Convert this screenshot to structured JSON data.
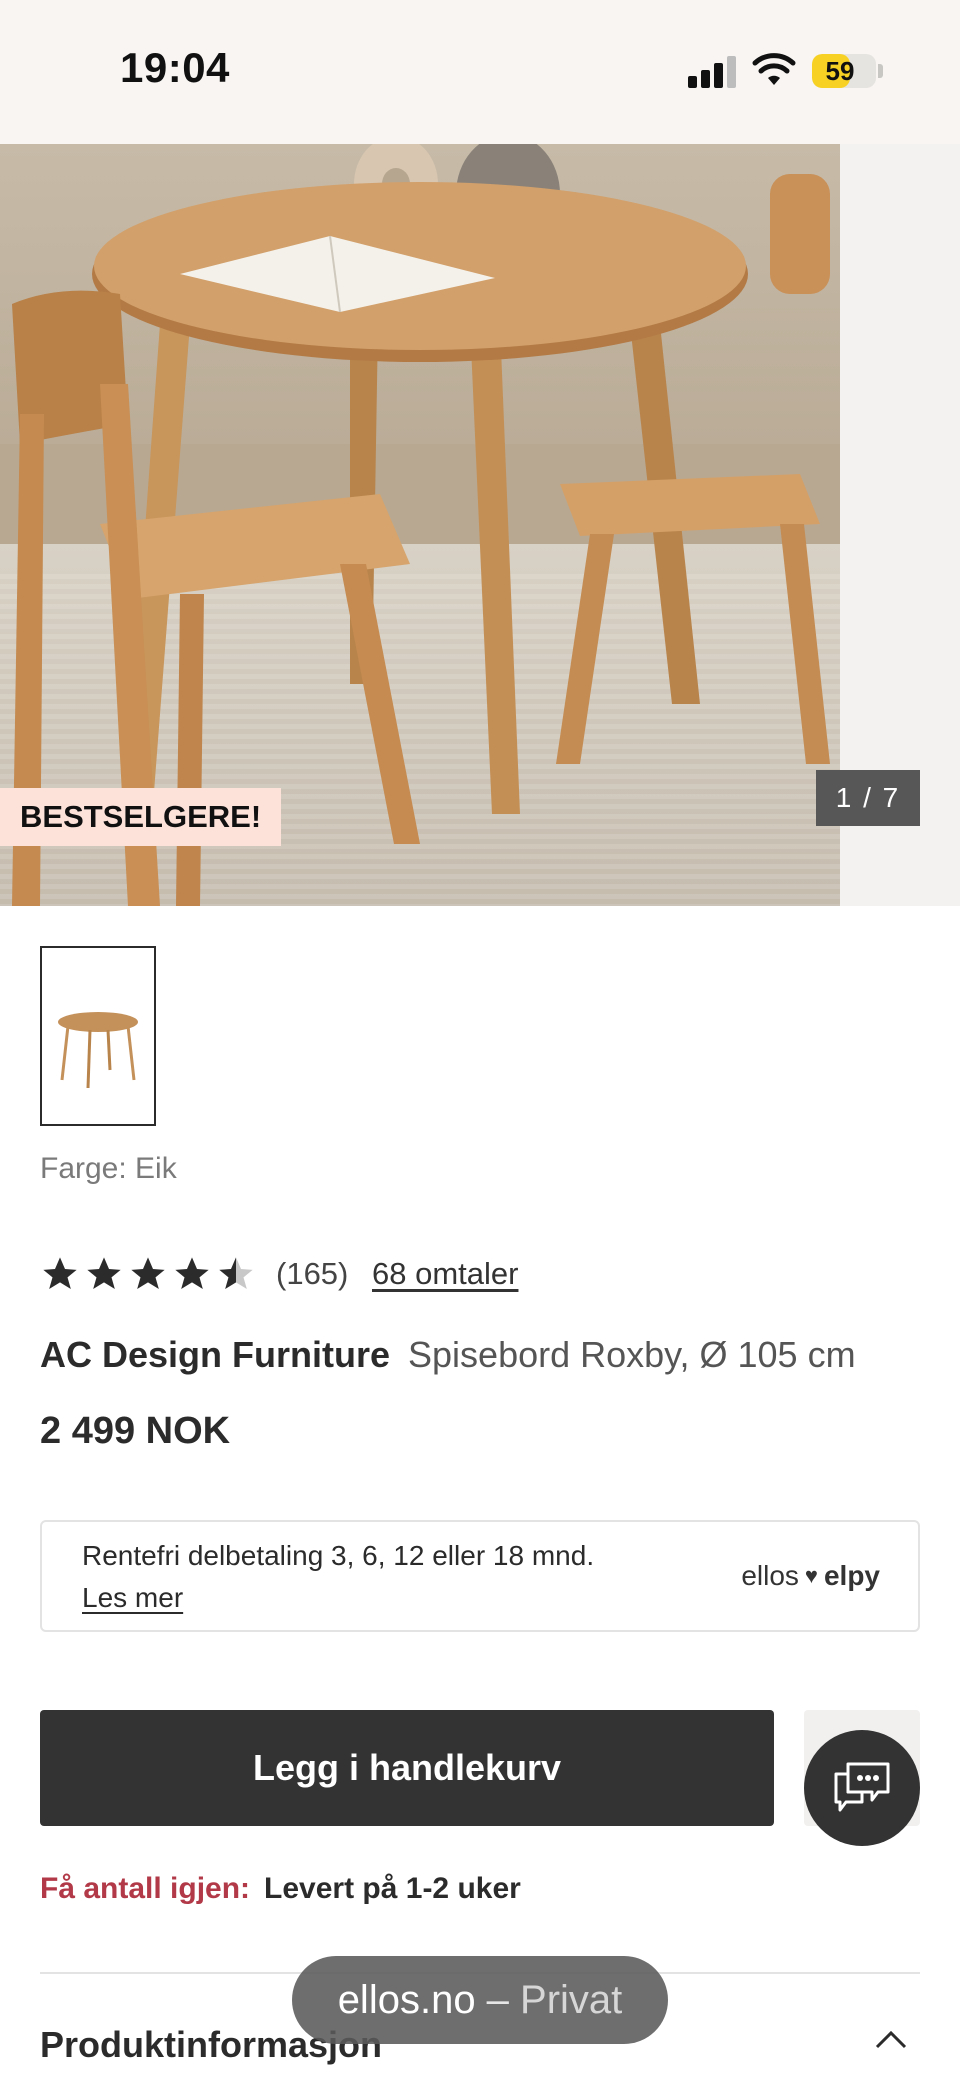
{
  "status_bar": {
    "time": "19:04",
    "battery": "59",
    "battery_level": 0.59
  },
  "gallery": {
    "badge": "BESTSELGERE!",
    "counter": "1 / 7",
    "color_label": "Farge: Eik"
  },
  "rating": {
    "stars": 4.5,
    "count": "(165)",
    "reviews_link": "68 omtaler"
  },
  "product": {
    "brand": "AC Design Furniture",
    "name": "Spisebord Roxby, Ø 105 cm",
    "price": "2 499 NOK"
  },
  "financing": {
    "text": "Rentefri delbetaling 3, 6, 12 eller 18 mnd.",
    "link": "Les mer",
    "logo_left": "ellos",
    "logo_right": "elpy"
  },
  "actions": {
    "add_to_cart": "Legg i handlekurv"
  },
  "delivery": {
    "label": "Få antall igjen:",
    "value": "Levert på 1-2 uker"
  },
  "sections": {
    "product_info": "Produktinformasjon"
  },
  "browser": {
    "host": "ellos.no",
    "separator": " – ",
    "mode": "Privat"
  },
  "icons": [
    "signal-icon",
    "wifi-icon",
    "battery-icon",
    "star-icon",
    "heart-icon",
    "chat-icon",
    "chevron-up-icon"
  ],
  "colors": {
    "accent_red": "#b23a48",
    "button_dark": "#333333",
    "badge_bg": "#fde2da",
    "battery_yellow": "#f7d224"
  }
}
